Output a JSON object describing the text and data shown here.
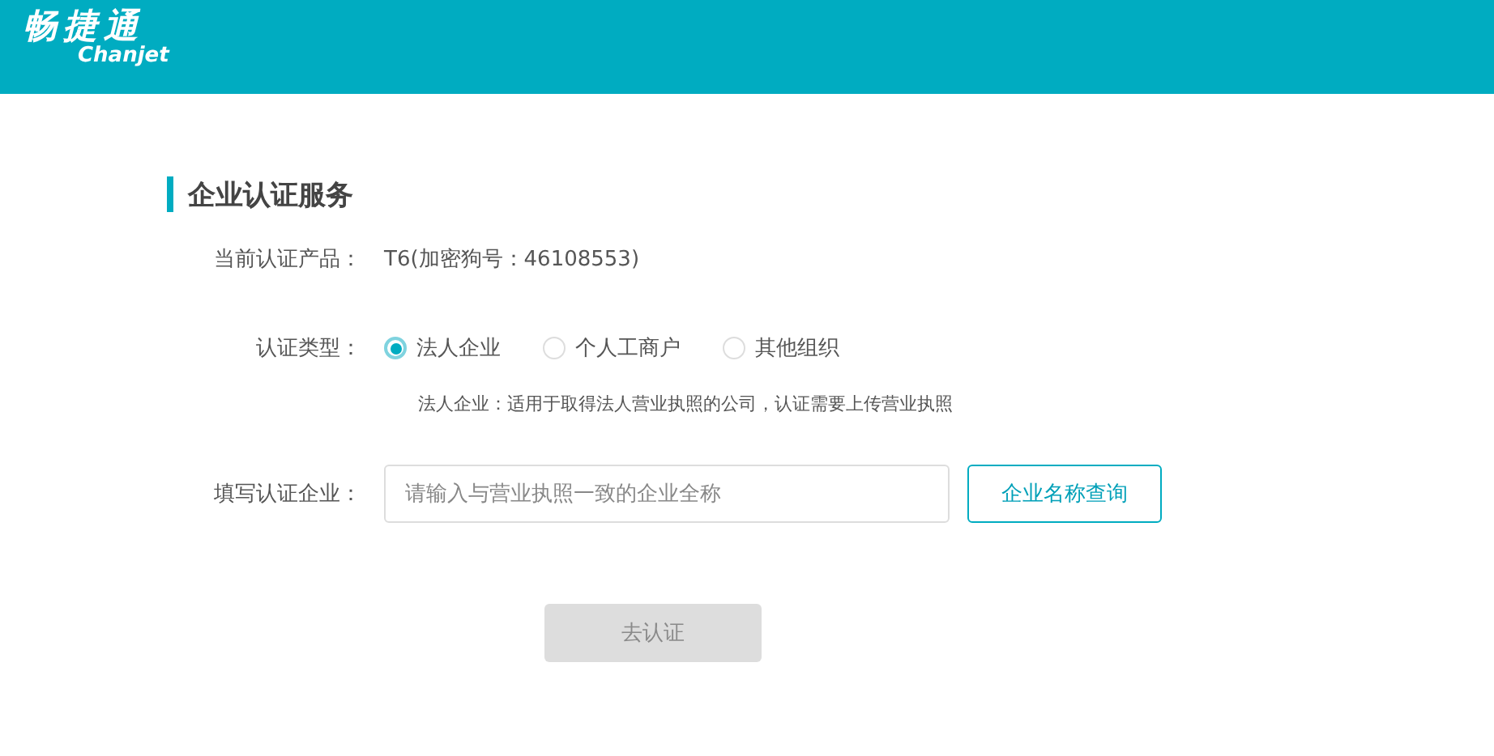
{
  "header": {
    "logo": "畅捷通",
    "logo_sub": "Chanjet"
  },
  "section": {
    "title": "企业认证服务"
  },
  "product": {
    "label": "当前认证产品：",
    "value": "T6(加密狗号：46108553)"
  },
  "type": {
    "label": "认证类型：",
    "options": [
      {
        "label": "法人企业",
        "selected": true
      },
      {
        "label": "个人工商户",
        "selected": false
      },
      {
        "label": "其他组织",
        "selected": false
      }
    ],
    "description": "法人企业：适用于取得法人营业执照的公司，认证需要上传营业执照"
  },
  "company": {
    "label": "填写认证企业：",
    "placeholder": "请输入与营业执照一致的企业全称",
    "lookup_button": "企业名称查询"
  },
  "submit": {
    "label": "去认证",
    "disabled": true
  }
}
